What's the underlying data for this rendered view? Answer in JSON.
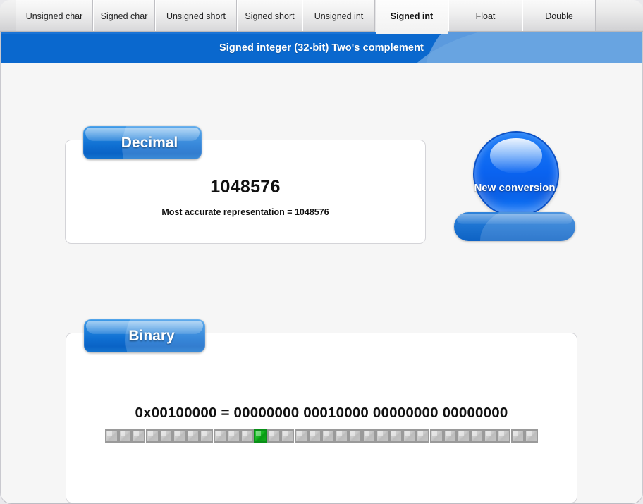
{
  "tabs": [
    {
      "label": "Unsigned char",
      "active": false
    },
    {
      "label": "Signed char",
      "active": false
    },
    {
      "label": "Unsigned short",
      "active": false
    },
    {
      "label": "Signed short",
      "active": false
    },
    {
      "label": "Unsigned int",
      "active": false
    },
    {
      "label": "Signed int",
      "active": true
    },
    {
      "label": "Float",
      "active": false
    },
    {
      "label": "Double",
      "active": false
    }
  ],
  "banner": {
    "title": "Signed integer (32-bit) Two's complement",
    "background_color": "#0a68ce",
    "accent_color": "#5b9ade"
  },
  "decimal": {
    "tag_label": "Decimal",
    "value": "1048576",
    "note": "Most accurate representation = 1048576"
  },
  "new_conversion": {
    "label": "New conversion",
    "orb_color": "#0a63f0",
    "pill_color": "#1d74d2"
  },
  "binary": {
    "tag_label": "Binary",
    "expression": "0x00100000 = 00000000 00010000 00000000 00000000",
    "hex": "0x00100000",
    "bit_count": 32,
    "set_bit_indices": [
      11
    ],
    "on_color": "#16b521",
    "off_color": "#c9c9c9",
    "bits": [
      "0",
      "0",
      "0",
      "0",
      "0",
      "0",
      "0",
      "0",
      "0",
      "0",
      "0",
      "1",
      "0",
      "0",
      "0",
      "0",
      "0",
      "0",
      "0",
      "0",
      "0",
      "0",
      "0",
      "0",
      "0",
      "0",
      "0",
      "0",
      "0",
      "0",
      "0",
      "0"
    ]
  }
}
